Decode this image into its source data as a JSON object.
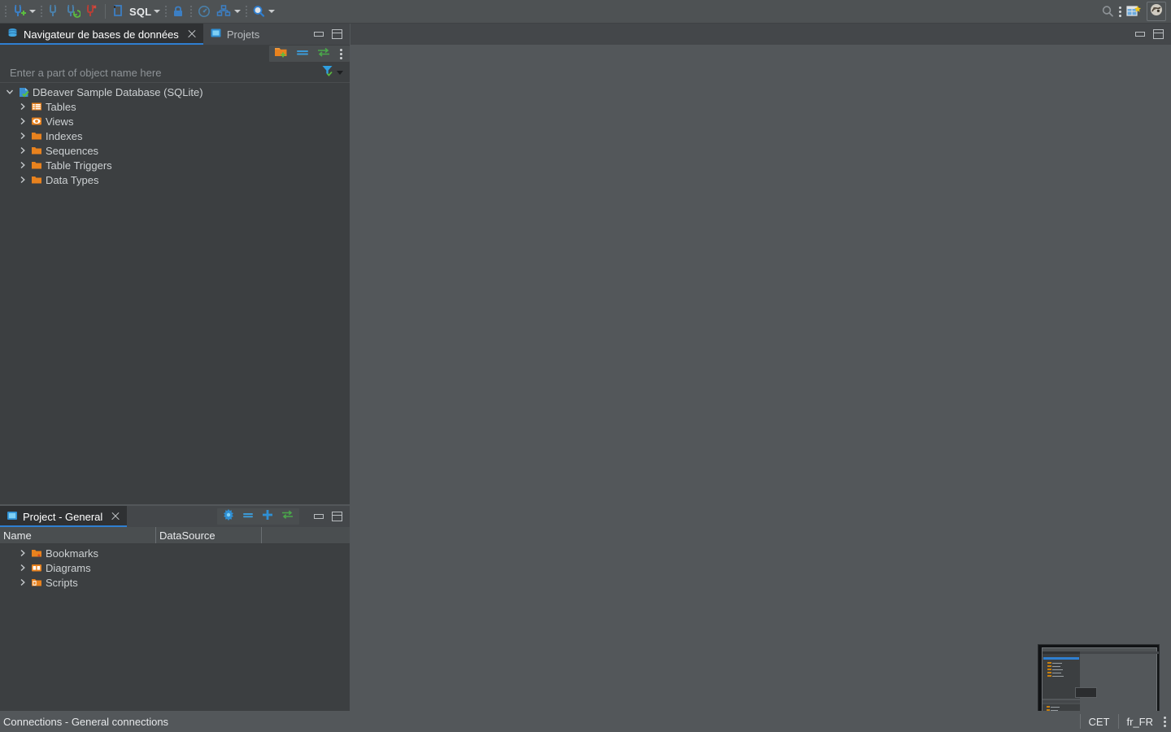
{
  "toolbar": {
    "items": [
      {
        "name": "new-database-connection",
        "icon": "plug-plus-icon",
        "label": "New Database Connection",
        "has_caret": true
      },
      {
        "name": "disconnect",
        "icon": "plug-icon",
        "label": "Disconnect"
      },
      {
        "name": "reconnect",
        "icon": "plug-refresh-icon",
        "label": "Invalidate/Reconnect"
      },
      {
        "name": "disconnect-all",
        "icon": "plug-broken-icon",
        "label": "Disconnect All"
      },
      {
        "name": "new-sql-editor",
        "icon": "sql-editor-icon",
        "label": "SQL",
        "has_caret": true
      },
      {
        "name": "commit-mode",
        "icon": "lock-icon",
        "label": "Commit mode"
      },
      {
        "name": "transaction-monitor",
        "icon": "gauge-icon",
        "label": "Transaction monitor"
      },
      {
        "name": "transaction-log",
        "icon": "transaction-icon",
        "label": "Transaction log",
        "has_caret": true
      },
      {
        "name": "search",
        "icon": "magnifier-icon",
        "label": "Search",
        "has_caret": true
      }
    ],
    "sql_label": "SQL",
    "right_items": [
      {
        "name": "global-search",
        "icon": "search-icon",
        "label": "Search"
      },
      {
        "name": "open-perspective",
        "icon": "new-window-icon",
        "label": "Open Perspective"
      },
      {
        "name": "user-profile",
        "icon": "avatar-icon",
        "label": "User profile"
      }
    ]
  },
  "navigator": {
    "tabs": [
      {
        "name": "database-navigator",
        "label": "Navigateur de bases de données",
        "active": true,
        "closable": true,
        "icon": "database-stack-icon"
      },
      {
        "name": "projects",
        "label": "Projets",
        "active": false,
        "closable": false,
        "icon": "project-folder-icon"
      }
    ],
    "toolbar": [
      {
        "name": "create-new-folder",
        "icon": "folder-plus-icon",
        "label": "Create new folder"
      },
      {
        "name": "collapse-all",
        "icon": "collapse-all-icon",
        "label": "Collapse all"
      },
      {
        "name": "link-with-editor",
        "icon": "link-editor-icon",
        "label": "Link with editor"
      },
      {
        "name": "view-menu",
        "icon": "vertical-dots-icon",
        "label": "View Menu"
      }
    ],
    "filter": {
      "placeholder": "Enter a part of object name here",
      "value": "",
      "icon": "filter-funnel-icon"
    },
    "tree": [
      {
        "label": "DBeaver Sample Database (SQLite)",
        "icon": "database-connected-icon",
        "expanded": true,
        "level": 0
      },
      {
        "label": "Tables",
        "icon": "tables-icon",
        "expanded": false,
        "level": 1
      },
      {
        "label": "Views",
        "icon": "views-eye-icon",
        "expanded": false,
        "level": 1
      },
      {
        "label": "Indexes",
        "icon": "folder-icon",
        "expanded": false,
        "level": 1
      },
      {
        "label": "Sequences",
        "icon": "folder-icon",
        "expanded": false,
        "level": 1
      },
      {
        "label": "Table Triggers",
        "icon": "folder-icon",
        "expanded": false,
        "level": 1
      },
      {
        "label": "Data Types",
        "icon": "folder-icon",
        "expanded": false,
        "level": 1
      }
    ],
    "window_buttons": [
      {
        "name": "minimize-panel-button",
        "icon": "minimize-icon"
      },
      {
        "name": "maximize-panel-button",
        "icon": "maximize-icon"
      }
    ]
  },
  "project_panel": {
    "tab": {
      "name": "project-general",
      "label": "Project - General",
      "icon": "project-square-icon",
      "closable": true
    },
    "toolbar": [
      {
        "name": "configure-columns",
        "icon": "gear-flower-icon",
        "label": "Configure columns"
      },
      {
        "name": "collapse-all",
        "icon": "collapse-all-icon",
        "label": "Collapse all"
      },
      {
        "name": "create-new-object",
        "icon": "plus-icon",
        "label": "Create new object"
      },
      {
        "name": "link-with-editor",
        "icon": "link-editor-icon",
        "label": "Link with editor"
      }
    ],
    "columns": [
      "Name",
      "DataSource",
      ""
    ],
    "rows": [
      {
        "name": "Bookmarks",
        "icon": "bookmarks-folder-icon",
        "datasource": ""
      },
      {
        "name": "Diagrams",
        "icon": "diagrams-folder-icon",
        "datasource": ""
      },
      {
        "name": "Scripts",
        "icon": "scripts-folder-icon",
        "datasource": ""
      }
    ],
    "window_buttons": [
      {
        "name": "minimize-panel-button",
        "icon": "minimize-icon"
      },
      {
        "name": "maximize-panel-button",
        "icon": "maximize-icon"
      }
    ]
  },
  "editor": {
    "content": "",
    "window_buttons": [
      {
        "name": "minimize-editor-button",
        "icon": "minimize-icon"
      },
      {
        "name": "maximize-editor-button",
        "icon": "maximize-icon"
      }
    ]
  },
  "statusbar": {
    "message": "Connections - General connections",
    "timezone": "CET",
    "locale": "fr_FR",
    "menu_icon": "vertical-dots-icon"
  },
  "thumbnail": {
    "name": "screenshot-preview-thumbnail",
    "caption": ""
  },
  "colors": {
    "accent_blue": "#2f7fd1",
    "panel_bg": "#3c3f41",
    "tab_bg": "#44474a",
    "editor_bg": "#53575a",
    "folder_orange": "#e8821e",
    "green": "#4caf50"
  }
}
